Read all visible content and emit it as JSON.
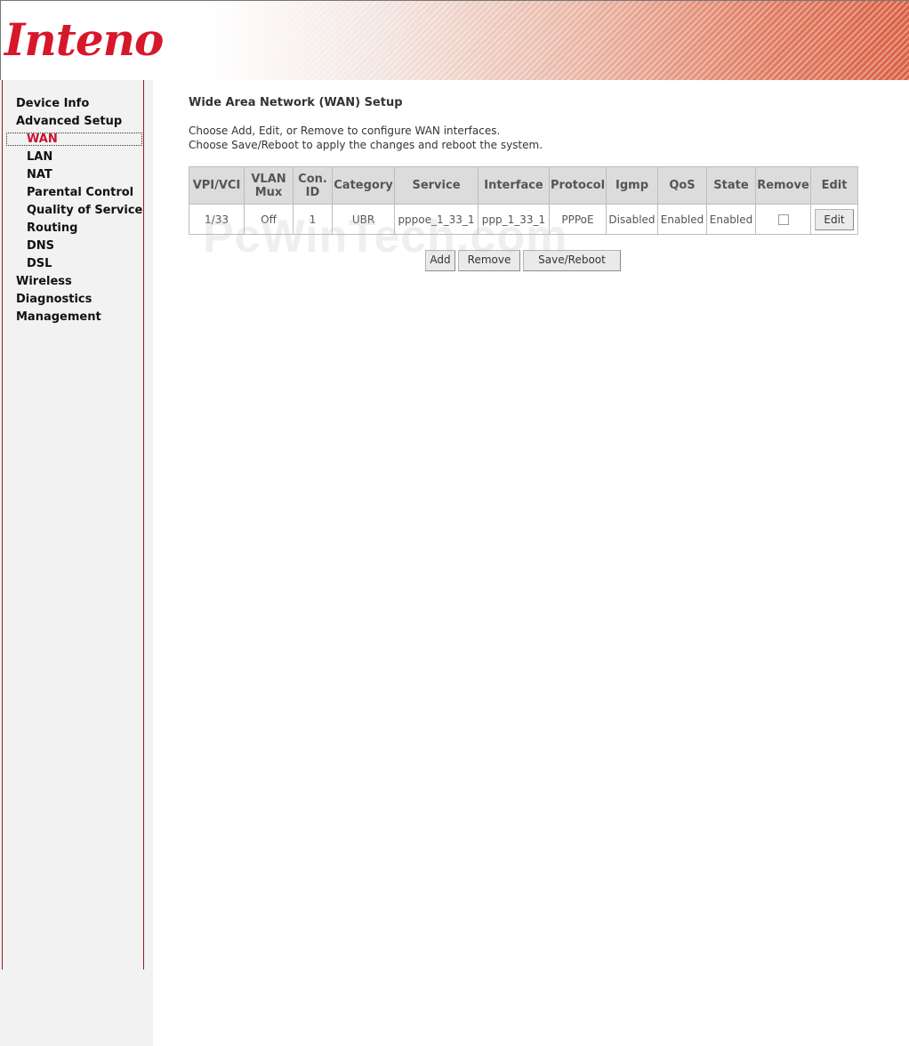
{
  "header": {
    "logo_text": "Inteno"
  },
  "sidebar": {
    "items": [
      {
        "label": "Device Info"
      },
      {
        "label": "Advanced Setup"
      },
      {
        "label": "WAN"
      },
      {
        "label": "LAN"
      },
      {
        "label": "NAT"
      },
      {
        "label": "Parental Control"
      },
      {
        "label": "Quality of Service"
      },
      {
        "label": "Routing"
      },
      {
        "label": "DNS"
      },
      {
        "label": "DSL"
      },
      {
        "label": "Wireless"
      },
      {
        "label": "Diagnostics"
      },
      {
        "label": "Management"
      }
    ]
  },
  "main": {
    "title": "Wide Area Network (WAN) Setup",
    "description_line1": "Choose Add, Edit, or Remove to configure WAN interfaces.",
    "description_line2": "Choose Save/Reboot to apply the changes and reboot the system."
  },
  "table": {
    "headers": [
      "VPI/VCI",
      "VLAN Mux",
      "Con. ID",
      "Category",
      "Service",
      "Interface",
      "Protocol",
      "Igmp",
      "QoS",
      "State",
      "Remove",
      "Edit"
    ],
    "header_lines": {
      "vlan_1": "VLAN",
      "vlan_2": "Mux",
      "con_1": "Con.",
      "con_2": "ID"
    },
    "rows": [
      {
        "vpi_vci": "1/33",
        "vlan_mux": "Off",
        "con_id": "1",
        "category": "UBR",
        "service": "pppoe_1_33_1",
        "interface": "ppp_1_33_1",
        "protocol": "PPPoE",
        "igmp": "Disabled",
        "qos": "Enabled",
        "state": "Enabled",
        "remove_checked": false,
        "edit_label": "Edit"
      }
    ]
  },
  "buttons": {
    "add": "Add",
    "remove": "Remove",
    "save_reboot": "Save/Reboot"
  },
  "watermark": "PcWinTech.com",
  "colors": {
    "accent_red": "#c8102e",
    "sidebar_border": "#a01722",
    "table_header_bg": "#dcdcdc"
  }
}
